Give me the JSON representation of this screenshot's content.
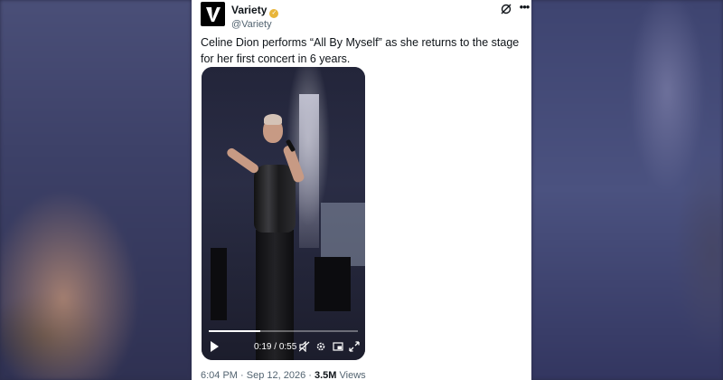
{
  "tweet": {
    "display_name": "Variety",
    "handle": "@Variety",
    "text": "Celine Dion performs “All By Myself” as she returns to the stage for her first concert in 6 years.",
    "timestamp": "6:04 PM · Sep 12, 2026",
    "separator": "·",
    "views_count": "3.5M",
    "views_label": "Views"
  },
  "video": {
    "elapsed": "0:19",
    "duration": "0:55",
    "progress": 0.345
  },
  "colors": {
    "verified_badge": "#e8b53a",
    "text_primary": "#0f1419",
    "text_secondary": "#536471"
  },
  "icons": {
    "logo": "variety-v-logo",
    "verified": "verified-badge-icon",
    "grok": "grok-icon",
    "more": "more-icon",
    "play": "play-icon",
    "mute": "volume-muted-icon",
    "settings": "gear-icon",
    "pip": "picture-in-picture-icon",
    "fullscreen": "fullscreen-icon"
  }
}
